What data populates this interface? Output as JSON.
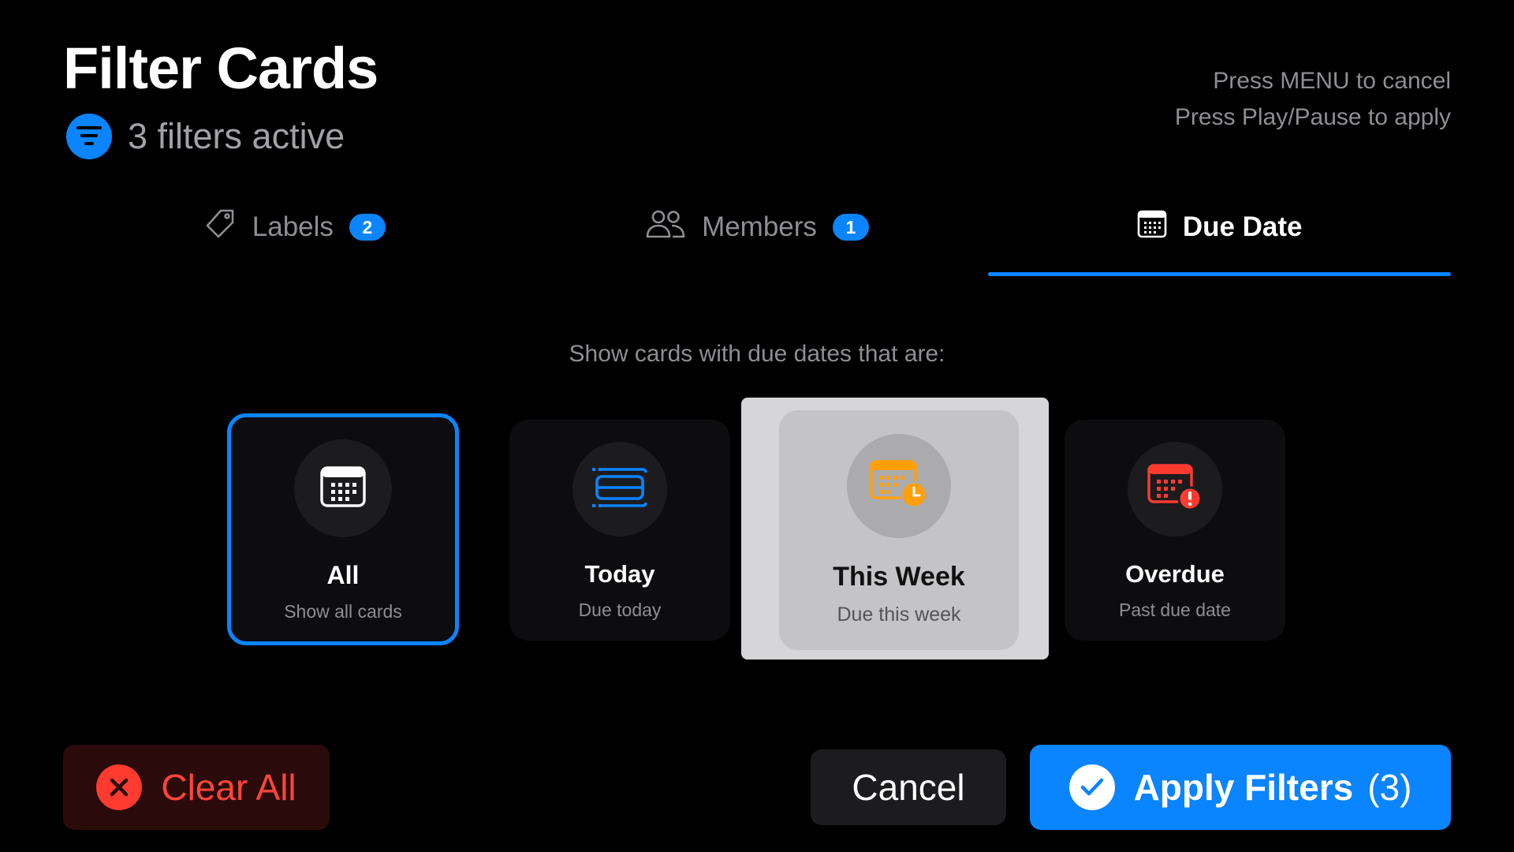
{
  "header": {
    "title": "Filter Cards",
    "status": "3 filters active",
    "status_icon": "filter-lines-icon"
  },
  "hints": {
    "cancel": "Press MENU to cancel",
    "apply": "Press Play/Pause to apply"
  },
  "tabs": [
    {
      "label": "Labels",
      "badge": "2",
      "icon": "tag-icon",
      "active": false
    },
    {
      "label": "Members",
      "badge": "1",
      "icon": "people-icon",
      "active": false
    },
    {
      "label": "Due Date",
      "badge": "",
      "icon": "calendar-icon",
      "active": true
    }
  ],
  "prompt": "Show cards with due dates that are:",
  "options": [
    {
      "label": "All",
      "sub": "Show all cards",
      "icon": "calendar-icon",
      "selected": true
    },
    {
      "label": "Today",
      "sub": "Due today",
      "icon": "today-icon",
      "selected": false
    },
    {
      "label": "This Week",
      "sub": "Due this week",
      "icon": "calendar-clock-icon",
      "focused": true
    },
    {
      "label": "Overdue",
      "sub": "Past due date",
      "icon": "calendar-alert-icon",
      "selected": false
    }
  ],
  "buttons": {
    "clear": "Clear All",
    "cancel": "Cancel",
    "apply": "Apply Filters",
    "apply_count": "(3)"
  },
  "colors": {
    "accent": "#0a84ff",
    "danger": "#ff453a",
    "week_icon": "#ff9f0a",
    "overdue_icon": "#ff3b30"
  }
}
